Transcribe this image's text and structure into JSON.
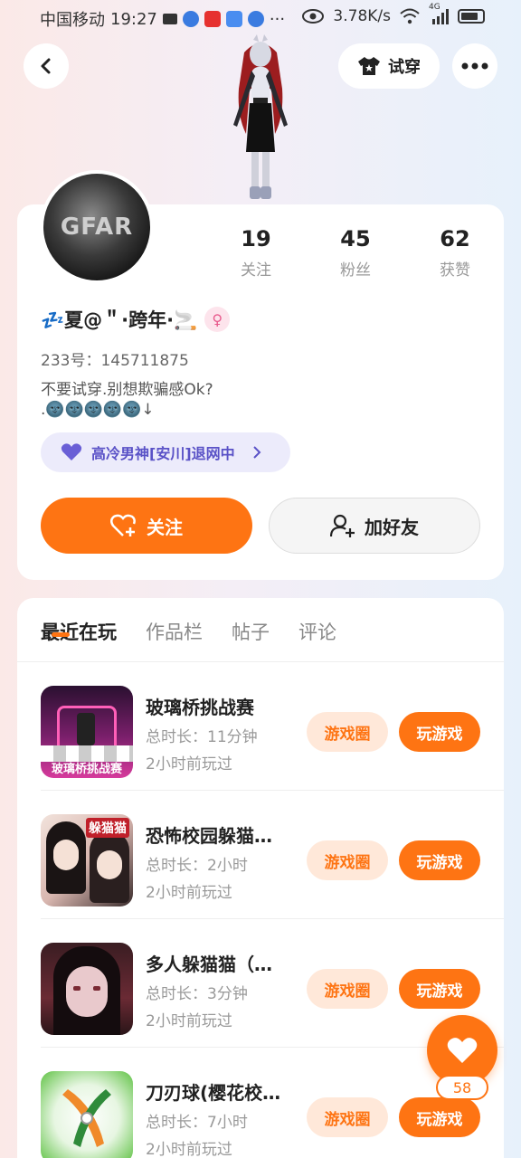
{
  "status_bar": {
    "carrier": "中国移动",
    "time": "19:27",
    "more": "···",
    "speed": "3.78K/s",
    "signal_label": "4G"
  },
  "nav": {
    "tryon_label": "试穿",
    "back_icon": "chevron-left-icon",
    "more_icon": "more-dots-icon"
  },
  "profile": {
    "avatar_text": "GFAR",
    "stats": [
      {
        "num": "19",
        "label": "关注"
      },
      {
        "num": "45",
        "label": "粉丝"
      },
      {
        "num": "62",
        "label": "获赞"
      }
    ],
    "nickname": "💤夏@＂·跨年·🚬",
    "gender_icon": "♀",
    "uid": "233号：145711875",
    "bio_line1": "不要试穿.别想欺骗感Ok?",
    "bio_line2": ".🌚🌚🌚🌚🌚↓",
    "tag": "高冷男神[安川]退网中",
    "follow_label": "关注",
    "add_friend_label": "加好友"
  },
  "tabs": [
    "最近在玩",
    "作品栏",
    "帖子",
    "评论"
  ],
  "games": [
    {
      "title": "玻璃桥挑战赛",
      "duration": "总时长：11分钟",
      "last_played": "2小时前玩过",
      "circle_label": "游戏圈",
      "play_label": "玩游戏",
      "thumb_text": "玻璃桥挑战赛"
    },
    {
      "title": "恐怖校园躲猫…",
      "duration": "总时长：2小时",
      "last_played": "2小时前玩过",
      "circle_label": "游戏圈",
      "play_label": "玩游戏",
      "thumb_text": "躲猫猫"
    },
    {
      "title": "多人躲猫猫（…",
      "duration": "总时长：3分钟",
      "last_played": "2小时前玩过",
      "circle_label": "游戏圈",
      "play_label": "玩游戏",
      "thumb_text": ""
    },
    {
      "title": "刀刃球(樱花校…",
      "duration": "总时长：7小时",
      "last_played": "2小时前玩过",
      "circle_label": "游戏圈",
      "play_label": "玩游戏",
      "thumb_text": ""
    }
  ],
  "like": {
    "count": "58"
  },
  "colors": {
    "accent": "#fe7413",
    "accent_light": "#ffe8d9",
    "tag_bg": "#ecebfb",
    "tag_text": "#5a52c7"
  }
}
